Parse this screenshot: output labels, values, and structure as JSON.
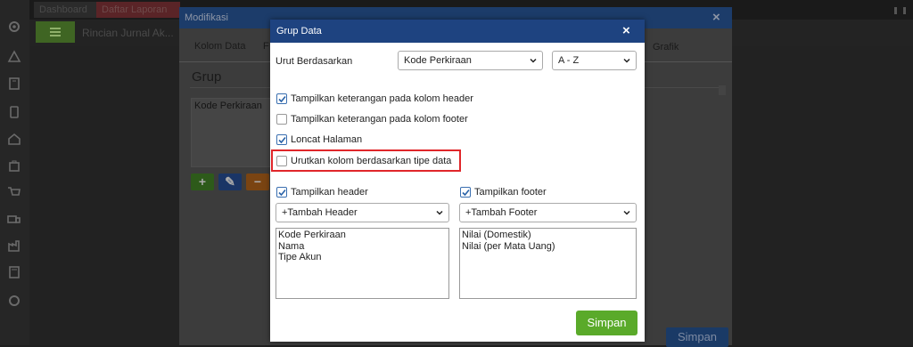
{
  "background": {
    "tabs": [
      "Dashboard",
      "Daftar Laporan"
    ],
    "page_title": "Rincian Jurnal Ak...",
    "save_label": "Simpan"
  },
  "modifikasi": {
    "title": "Modifikasi",
    "close_symbol": "×",
    "tabs": [
      "Kolom Data",
      "F",
      "Grafik"
    ],
    "section_title": "Grup",
    "group_list": [
      "Kode Perkiraan"
    ],
    "buttons": [
      "+",
      "✎",
      "−"
    ],
    "save_label": "Simpan"
  },
  "dialog": {
    "title": "Grup Data",
    "close_symbol": "×",
    "sort_label": "Urut Berdasarkan",
    "sort_field": "Kode Perkiraan",
    "sort_order": "A - Z",
    "options": [
      {
        "label": "Tampilkan keterangan pada kolom header",
        "checked": true
      },
      {
        "label": "Tampilkan keterangan pada kolom footer",
        "checked": false
      },
      {
        "label": "Loncat Halaman",
        "checked": true
      },
      {
        "label": "Urutkan kolom berdasarkan tipe data",
        "checked": false,
        "highlighted": true
      }
    ],
    "show_header": {
      "label": "Tampilkan header",
      "checked": true
    },
    "show_footer": {
      "label": "Tampilkan footer",
      "checked": true
    },
    "add_header": "+Tambah Header",
    "add_footer": "+Tambah Footer",
    "header_items": [
      "Kode Perkiraan",
      "Nama",
      "Tipe Akun"
    ],
    "footer_items": [
      "Nilai (Domestik)",
      "Nilai (per Mata Uang)"
    ],
    "save_label": "Simpan"
  },
  "colors": {
    "dialog_header": "#1e4380",
    "save_button": "#5aaa2a",
    "highlight": "#e0262a",
    "checkbox_check": "#2a63a8"
  }
}
